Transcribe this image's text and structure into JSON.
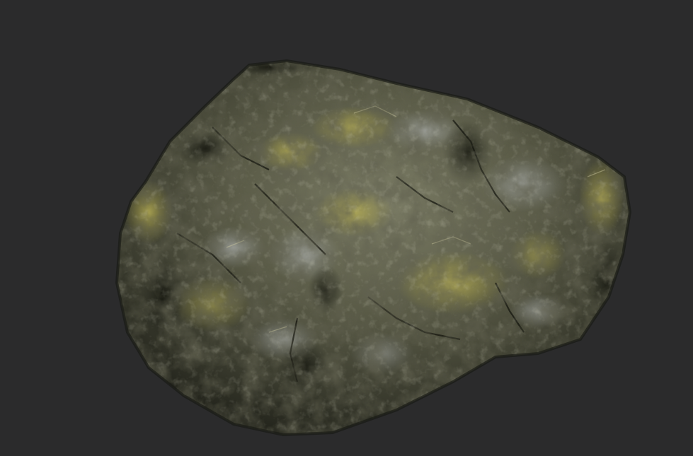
{
  "viewport": {
    "background_color": "#2b2b2c",
    "subject": "rock-model"
  },
  "rock": {
    "base_color": "#5a5b47",
    "dark_color": "#1f211a",
    "mid_color": "#6e6f5a",
    "highlight_color": "#b8b58a",
    "moss_color": "#9a9440",
    "gray_color": "#8c8f8c"
  }
}
